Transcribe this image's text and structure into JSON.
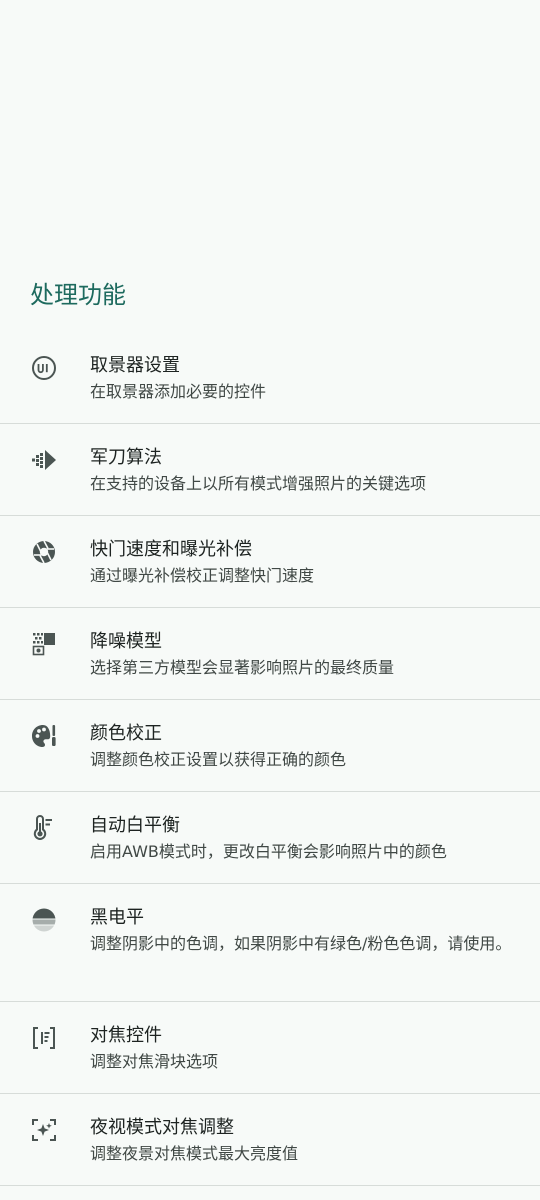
{
  "section": {
    "title": "处理功能"
  },
  "items": [
    {
      "icon": "ui-circle-icon",
      "title": "取景器设置",
      "summary": "在取景器添加必要的控件"
    },
    {
      "icon": "sabre-arrow-icon",
      "title": "军刀算法",
      "summary": "在支持的设备上以所有模式增强照片的关键选项"
    },
    {
      "icon": "shutter-aperture-icon",
      "title": "快门速度和曝光补偿",
      "summary": "通过曝光补偿校正调整快门速度"
    },
    {
      "icon": "noise-model-icon",
      "title": "降噪模型",
      "summary": "选择第三方模型会显著影响照片的最终质量"
    },
    {
      "icon": "palette-icon",
      "title": "颜色校正",
      "summary": "调整颜色校正设置以获得正确的颜色"
    },
    {
      "icon": "thermometer-icon",
      "title": "自动白平衡",
      "summary": "启用AWB模式时，更改白平衡会影响照片中的颜色"
    },
    {
      "icon": "black-level-icon",
      "title": "黑电平",
      "summary": "调整阴影中的色调，如果阴影中有绿色/粉色色调，请使用。"
    },
    {
      "icon": "focus-control-icon",
      "title": "对焦控件",
      "summary": "调整对焦滑块选项"
    },
    {
      "icon": "night-focus-icon",
      "title": "夜视模式对焦调整",
      "summary": "调整夜景对焦模式最大亮度值"
    }
  ],
  "colors": {
    "accent": "#1d6a5e",
    "icon": "#4b5553",
    "background": "#f7faf8",
    "divider": "#d7dcd9"
  }
}
